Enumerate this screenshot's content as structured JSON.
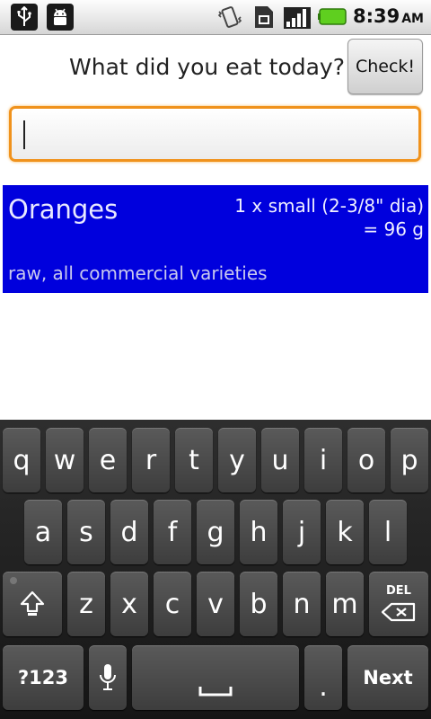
{
  "status_bar": {
    "time": "8:39",
    "ampm": "AM",
    "left_icons": [
      "usb-icon",
      "android-debug-icon"
    ],
    "right_icons": [
      "vibrate-icon",
      "sim-card-icon",
      "signal-icon",
      "battery-icon"
    ]
  },
  "header": {
    "question": "What did you eat today?",
    "check_label": "Check!"
  },
  "search": {
    "value": "",
    "placeholder": ""
  },
  "result": {
    "name": "Oranges",
    "portion_line1": "1 x small (2-3/8\" dia)",
    "portion_line2": "= 96 g",
    "description": "raw, all commercial varieties"
  },
  "keyboard": {
    "row1": [
      "q",
      "w",
      "e",
      "r",
      "t",
      "y",
      "u",
      "i",
      "o",
      "p"
    ],
    "row2": [
      "a",
      "s",
      "d",
      "f",
      "g",
      "h",
      "j",
      "k",
      "l"
    ],
    "row3": [
      "z",
      "x",
      "c",
      "v",
      "b",
      "n",
      "m"
    ],
    "del_label": "DEL",
    "symbols_label": "?123",
    "period_label": ".",
    "next_label": "Next"
  },
  "colors": {
    "result_bg": "#0000dd",
    "input_focus": "#f0921c",
    "battery": "#5fcf1f"
  }
}
